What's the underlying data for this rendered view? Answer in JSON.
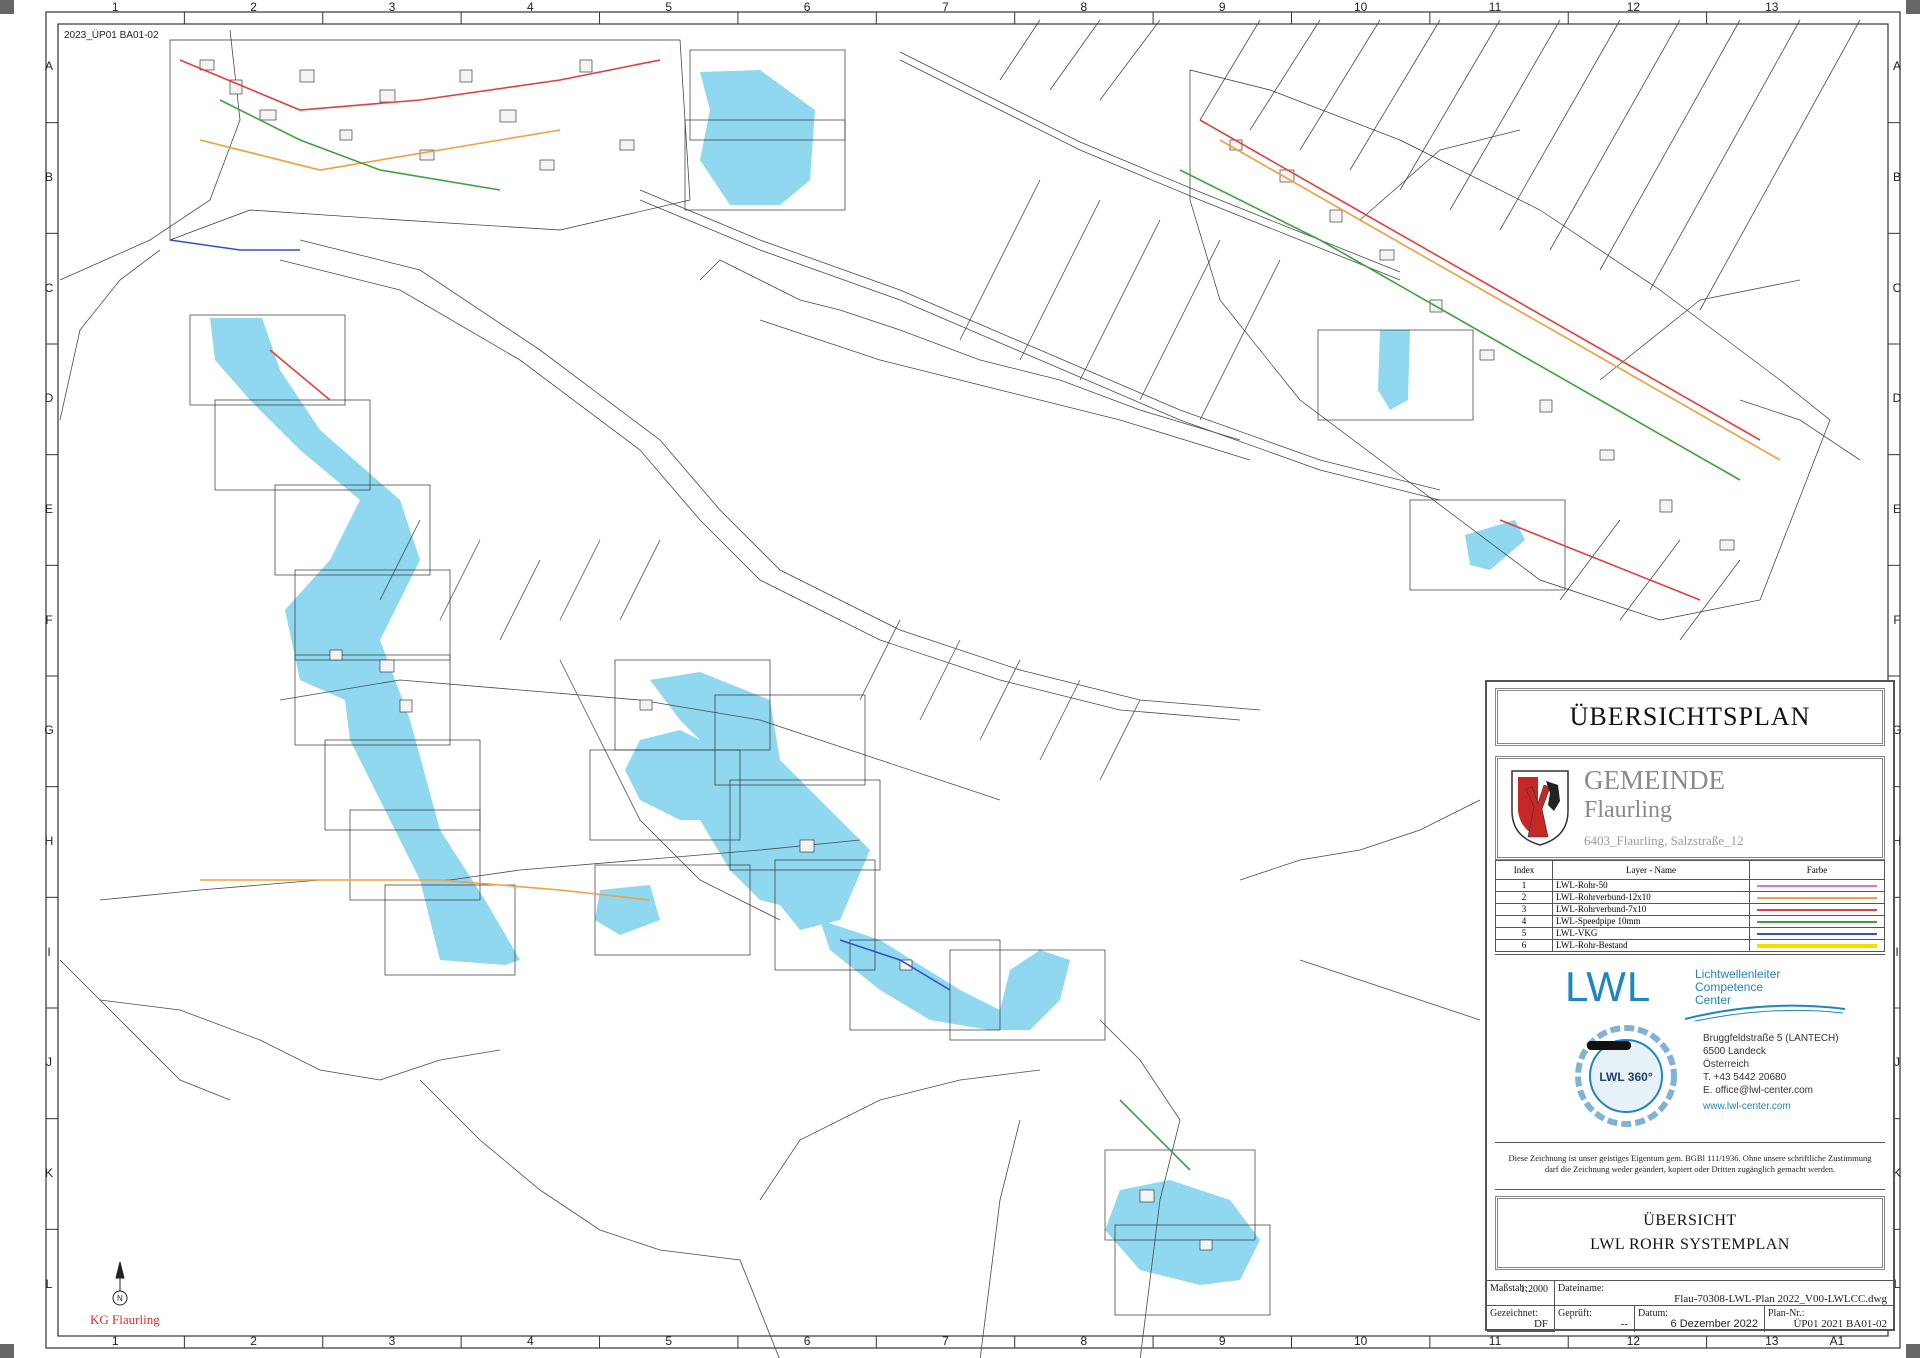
{
  "sheet": {
    "file_tag": "2023_ÜP01 BA01-02",
    "grid_columns": [
      "1",
      "2",
      "3",
      "4",
      "5",
      "6",
      "7",
      "8",
      "9",
      "10",
      "11",
      "12",
      "13"
    ],
    "grid_rows": [
      "A",
      "B",
      "C",
      "D",
      "E",
      "F",
      "G",
      "H",
      "I",
      "J",
      "K",
      "L"
    ],
    "north_label": "KG Flaurling"
  },
  "title_block": {
    "title": "ÜBERSICHTSPLAN",
    "gemeinde": "GEMEINDE",
    "gemeinde_name": "Flaurling",
    "project_address": "6403_Flaurling, Salzstraße_12",
    "legend_headers": {
      "index": "Index",
      "layer": "Layer - Name",
      "farbe": "Farbe"
    },
    "legend": [
      {
        "index": "1",
        "name": "LWL-Rohr-50",
        "color": "#e070e0"
      },
      {
        "index": "2",
        "name": "LWL-Rohrverbund-12x10",
        "color": "#f0a040"
      },
      {
        "index": "3",
        "name": "LWL-Rohrverbund-7x10",
        "color": "#e04040"
      },
      {
        "index": "4",
        "name": "LWL-Speedpipe 10mm",
        "color": "#40a040"
      },
      {
        "index": "5",
        "name": "LWL-VKG",
        "color": "#3050d0"
      },
      {
        "index": "6",
        "name": "LWL-Rohr-Bestand",
        "color": "#f0e000"
      }
    ],
    "company": {
      "logo_text": "LWL",
      "tagline": [
        "Lichtwellenleiter",
        "Competence",
        "Center"
      ],
      "badge_text": "LWL 360°",
      "address_lines": [
        "Bruggfeldstraße 5 (LANTECH)",
        "6500 Landeck",
        "Österreich",
        "T.  +43 5442 20680",
        "E.  office@lwl-center.com"
      ],
      "web": "www.lwl-center.com"
    },
    "notice": [
      "Diese Zeichnung ist unser geistiges Eigentum gem. BGBl 111/1936. Ohne unsere schriftliche Zustimmung",
      "darf die Zeichnung weder geändert, kopiert oder Dritten zugänglich gemacht werden."
    ],
    "subtitle_1": "ÜBERSICHT",
    "subtitle_2": "LWL ROHR SYSTEMPLAN",
    "meta": {
      "massstab_label": "Maßstab:",
      "massstab": "1:2000",
      "dateiname_label": "Dateiname:",
      "dateiname": "Flau-70308-LWL-Plan 2022_V00-LWLCC.dwg",
      "gezeichnet_label": "Gezeichnet:",
      "gezeichnet": "DF",
      "geprueft_label": "Geprüft:",
      "geprueft": "--",
      "datum_label": "Datum:",
      "datum": "6 Dezember 2022",
      "plannr_label": "Plan-Nr.:",
      "plannr": "ÜP01 2021 BA01-02",
      "format": "A1"
    }
  },
  "colors": {
    "highlight": "#8fd8ef",
    "parcel": "#4a4a4a",
    "road": "#555555",
    "frame": "#333333",
    "brand": "#1f86c0"
  }
}
